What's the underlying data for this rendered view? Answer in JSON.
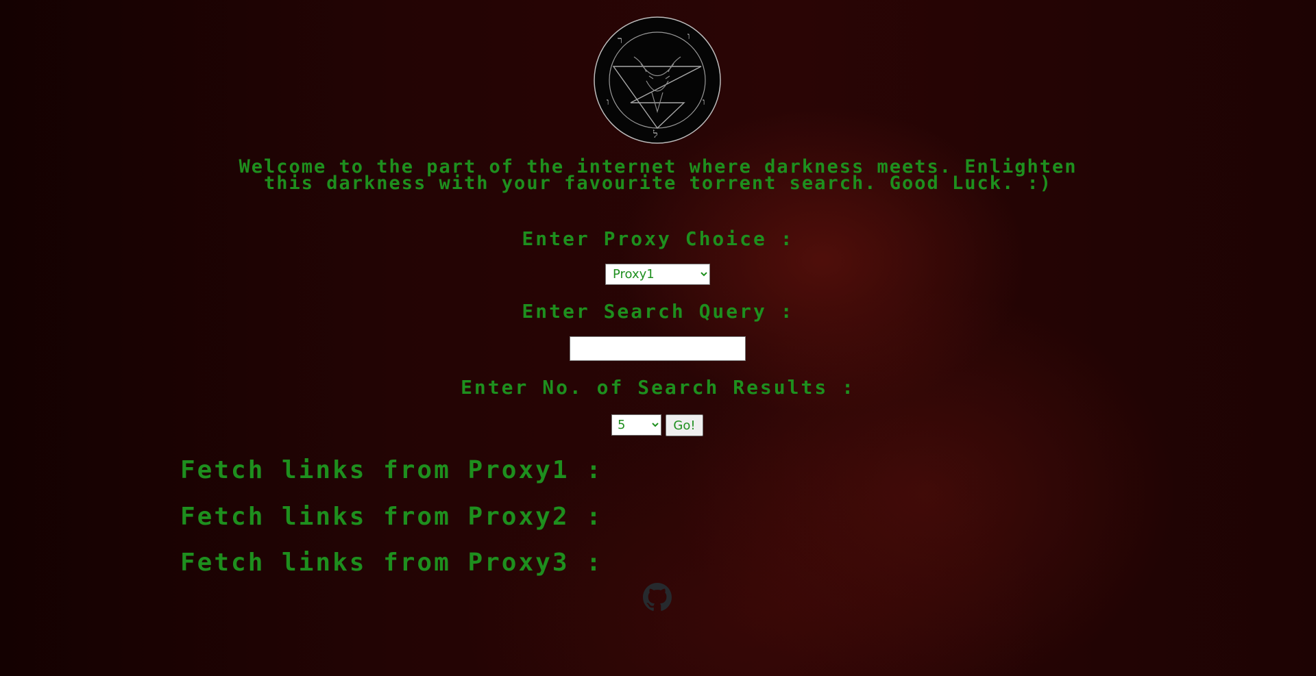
{
  "welcome": {
    "line1": "Welcome to the part of the internet where darkness meets. Enlighten",
    "line2": "this darkness with your favourite torrent search. Good Luck. :)"
  },
  "form": {
    "proxy_label": "Enter Proxy Choice :",
    "proxy_selected": "Proxy1",
    "query_label": "Enter Search Query :",
    "query_value": "",
    "count_label": "Enter No. of Search Results :",
    "count_selected": "5",
    "go_label": "Go!"
  },
  "fetch_links": [
    {
      "label": "Fetch links from Proxy1 :"
    },
    {
      "label": "Fetch links from Proxy2 :"
    },
    {
      "label": "Fetch links from Proxy3 :"
    }
  ],
  "colors": {
    "text_green": "#1e8f1e",
    "background": "#1e0303"
  },
  "icons": {
    "logo": "pentagram-goat-seal-icon",
    "footer": "github-icon"
  }
}
